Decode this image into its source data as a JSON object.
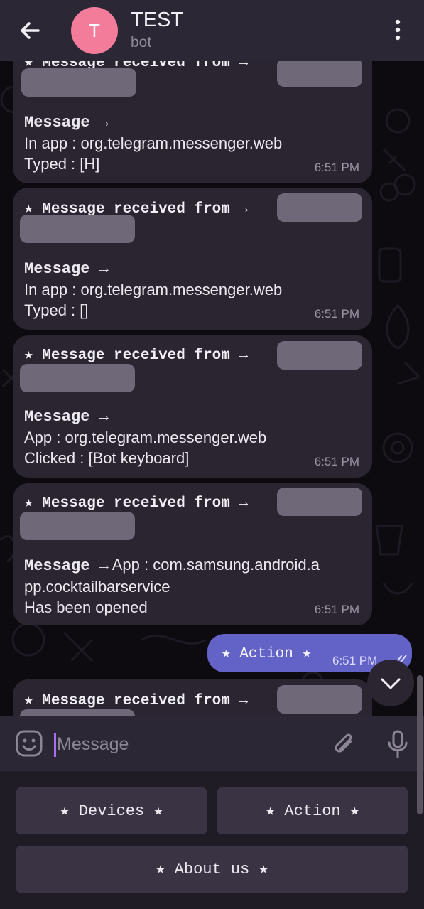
{
  "header": {
    "avatar_letter": "T",
    "title": "TEST",
    "subtitle": "bot"
  },
  "messages": [
    {
      "header": "★ Message received from →",
      "label": "Message →",
      "lines": [
        "In app : org.telegram.messenger.web",
        "Typed : [H]"
      ],
      "time": "6:51 PM"
    },
    {
      "header": "★ Message received from →",
      "label": "Message →",
      "lines": [
        "In app : org.telegram.messenger.web",
        "Typed : []"
      ],
      "time": "6:51 PM"
    },
    {
      "header": "★ Message received from →",
      "label": "Message →",
      "lines": [
        "App : org.telegram.messenger.web",
        "Clicked : [Bot keyboard]"
      ],
      "time": "6:51 PM"
    },
    {
      "header": "★ Message received from →",
      "label": "Message →",
      "inline_text": "App : com.samsung.android.a",
      "lines": [
        "pp.cocktailbarservice",
        "Has been opened"
      ],
      "time": "6:51 PM"
    },
    {
      "header": "★ Message received from →"
    }
  ],
  "outgoing": {
    "text": "★ Action ★",
    "time": "6:51 PM"
  },
  "composer": {
    "placeholder": "Message"
  },
  "keyboard": {
    "buttons": [
      "★ Devices ★",
      "★ Action ★",
      "★ About us ★"
    ]
  },
  "colors": {
    "header_bg": "#2c2734",
    "bubble_in": "#2b2532",
    "bubble_out": "#6362c6",
    "avatar": "#f27c9a",
    "accent_cursor": "#a770f0"
  },
  "icons": [
    "back-arrow-icon",
    "more-vertical-icon",
    "emoji-icon",
    "attach-icon",
    "mic-icon",
    "chevron-down-icon",
    "double-check-icon"
  ]
}
